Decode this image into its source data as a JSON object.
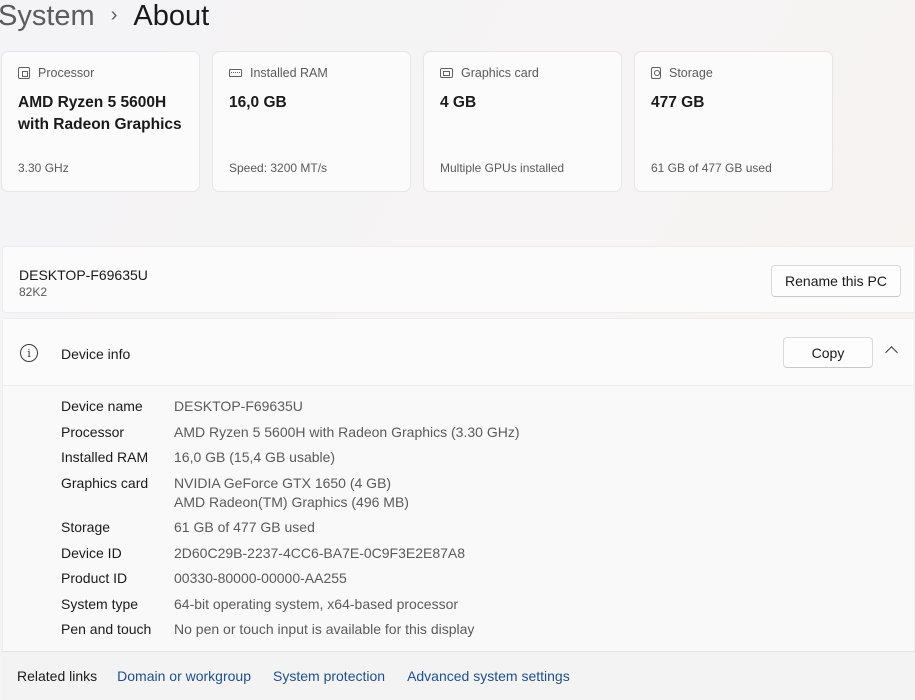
{
  "breadcrumb": {
    "parent": "System",
    "separator": "›",
    "current": "About"
  },
  "cards": [
    {
      "icon": "processor-icon",
      "label": "Processor",
      "value": "AMD Ryzen 5 5600H with Radeon Graphics",
      "sub": "3.30 GHz"
    },
    {
      "icon": "ram-icon",
      "label": "Installed RAM",
      "value": "16,0 GB",
      "sub": "Speed: 3200 MT/s"
    },
    {
      "icon": "graphics-card-icon",
      "label": "Graphics card",
      "value": "4 GB",
      "sub": "Multiple GPUs installed"
    },
    {
      "icon": "storage-icon",
      "label": "Storage",
      "value": "477 GB",
      "sub": "61 GB of 477 GB used"
    }
  ],
  "pc": {
    "name": "DESKTOP-F69635U",
    "model": "82K2",
    "rename_label": "Rename this PC"
  },
  "device_info": {
    "title": "Device info",
    "copy_label": "Copy",
    "specs": [
      {
        "label": "Device name",
        "value": "DESKTOP-F69635U"
      },
      {
        "label": "Processor",
        "value": "AMD Ryzen 5 5600H with Radeon Graphics (3.30 GHz)"
      },
      {
        "label": "Installed RAM",
        "value": "16,0 GB (15,4 GB usable)"
      },
      {
        "label": "Graphics card",
        "value": "NVIDIA GeForce GTX 1650 (4 GB)",
        "value2": "AMD Radeon(TM) Graphics (496 MB)"
      },
      {
        "label": "Storage",
        "value": "61 GB of 477 GB used"
      },
      {
        "label": "Device ID",
        "value": "2D60C29B-2237-4CC6-BA7E-0C9F3E2E87A8"
      },
      {
        "label": "Product ID",
        "value": "00330-80000-00000-AA255"
      },
      {
        "label": "System type",
        "value": "64-bit operating system, x64-based processor"
      },
      {
        "label": "Pen and touch",
        "value": "No pen or touch input is available for this display"
      }
    ]
  },
  "related": {
    "label": "Related links",
    "links": [
      "Domain or workgroup",
      "System protection",
      "Advanced system settings"
    ]
  }
}
